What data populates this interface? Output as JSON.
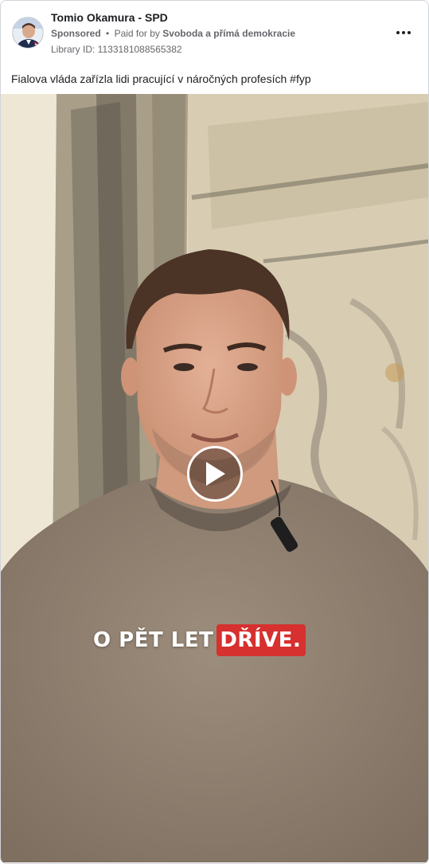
{
  "post": {
    "page_name": "Tomio Okamura - SPD",
    "sponsored": "Sponsored",
    "separator": "•",
    "paid_for_prefix": "Paid for by",
    "payer": "Svoboda a přímá demokracie",
    "library_id": "Library ID: 1133181088565382",
    "message": "Fialova vláda zařízla lidi pracující v náročných profesích #fyp",
    "more_icon": "more-horizontal-icon"
  },
  "video": {
    "caption_plain": "O PĚT LET",
    "caption_highlight": "DŘÍVE.",
    "highlight_color": "#d6302f",
    "play_icon": "play-icon"
  }
}
